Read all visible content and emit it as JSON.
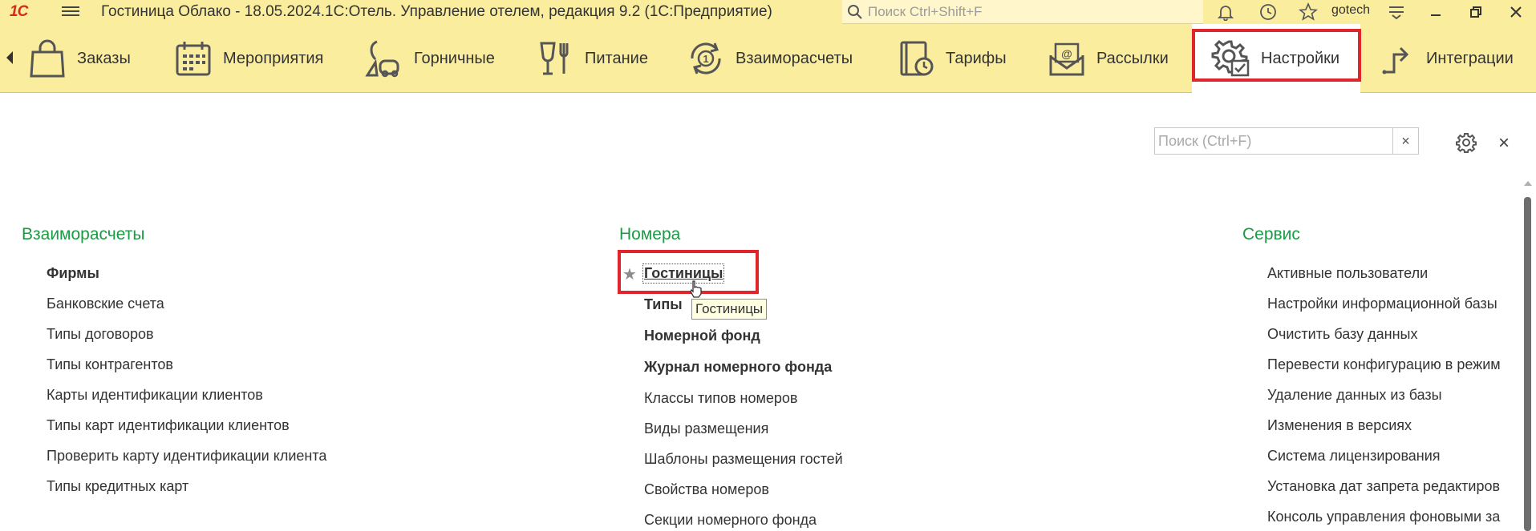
{
  "titlebar": {
    "logo": "1С",
    "title": "Гостиница Облако - 18.05.2024.1С:Отель. Управление отелем, редакция 9.2  (1С:Предприятие)",
    "search_placeholder": "Поиск Ctrl+Shift+F",
    "user": "gotech"
  },
  "sections": {
    "items": [
      {
        "label": "Заказы",
        "icon": "shopping-bag-icon"
      },
      {
        "label": "Мероприятия",
        "icon": "calendar-icon"
      },
      {
        "label": "Горничные",
        "icon": "vacuum-cleaner-icon"
      },
      {
        "label": "Питание",
        "icon": "glass-fork-icon"
      },
      {
        "label": "Взаиморасчеты",
        "icon": "coin-cycle-icon"
      },
      {
        "label": "Тарифы",
        "icon": "tariff-book-icon"
      },
      {
        "label": "Рассылки",
        "icon": "mail-at-icon"
      },
      {
        "label": "Настройки",
        "icon": "gear-check-icon",
        "active": true
      },
      {
        "label": "Интеграции",
        "icon": "integration-arrow-icon"
      }
    ]
  },
  "content": {
    "search_placeholder": "Поиск (Ctrl+F)",
    "clear": "×",
    "close": "×",
    "col1": {
      "title": "Взаиморасчеты",
      "links": [
        "Фирмы",
        "Банковские счета",
        "Типы договоров",
        "Типы контрагентов",
        "Карты идентификации клиентов",
        "Типы карт идентификации клиентов",
        "Проверить карту идентификации клиента",
        "Типы кредитных карт"
      ]
    },
    "col2": {
      "title": "Номера",
      "links": [
        "Гостиницы",
        "Типы",
        "Номерной фонд",
        "Журнал номерного фонда",
        "Классы типов номеров",
        "Виды размещения",
        "Шаблоны размещения гостей",
        "Свойства номеров",
        "Секции номерного фонда"
      ]
    },
    "col3": {
      "title": "Сервис",
      "links": [
        "Активные пользователи",
        "Настройки информационной базы",
        "Очистить базу данных",
        "Перевести конфигурацию в режим",
        "Удаление данных из базы",
        "Изменения в версиях",
        "Система лицензирования",
        "Установка дат запрета редактиров",
        "Консоль управления фоновыми за"
      ]
    },
    "tooltip": "Гостиницы"
  },
  "colors": {
    "panel_bg": "#fbed9e",
    "group_title": "#1a9b44",
    "highlight": "#e0262b"
  }
}
